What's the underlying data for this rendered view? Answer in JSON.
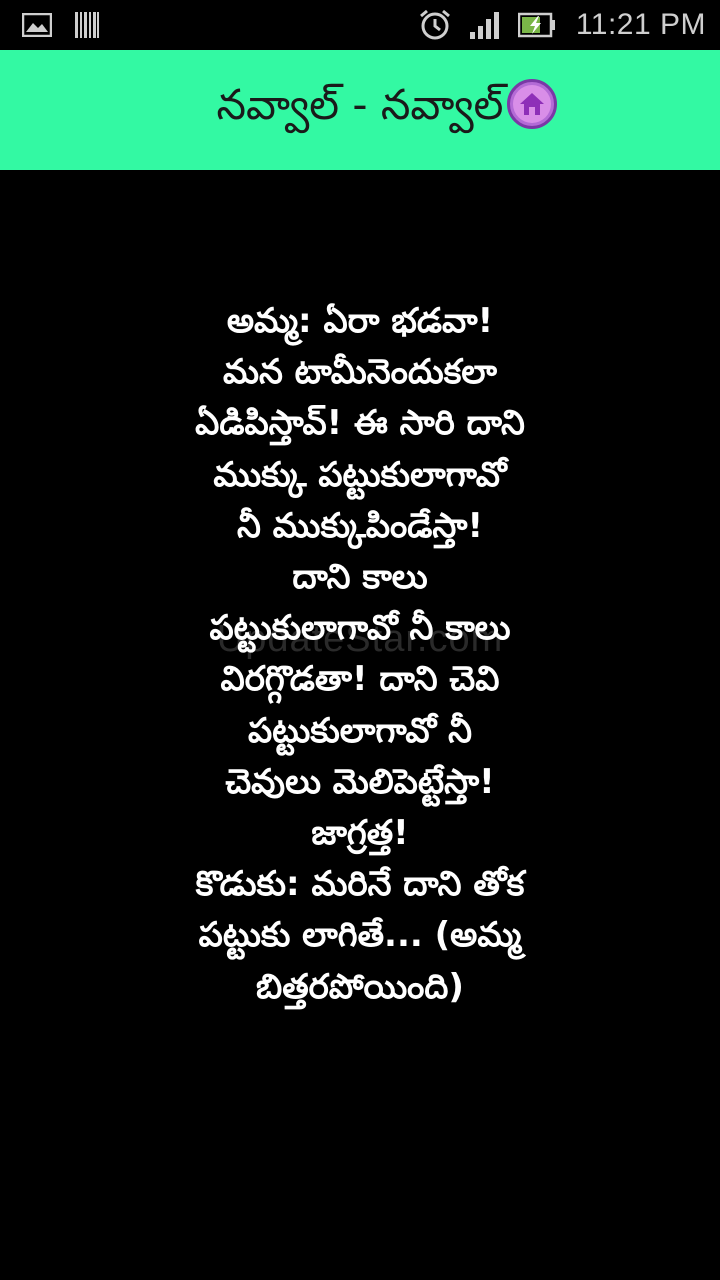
{
  "status_bar": {
    "time": "11:21 PM",
    "icons": [
      "gallery-icon",
      "barcode-icon",
      "alarm-icon",
      "signal-icon",
      "battery-charging-icon"
    ]
  },
  "app_bar": {
    "title": "నవ్వాల్ - నవ్వాల్",
    "home_icon": "home-icon"
  },
  "content": {
    "watermark": "UpdateStar.com",
    "joke_lines": [
      "అమ్మ: ఏరా భడవా!",
      "మన టామీనెందుకలా",
      "ఏడిపిస్తావ్! ఈ సారి దాని",
      "ముక్కు పట్టుకులాగావో",
      "నీ ముక్కుపిండేస్తా!",
      "దాని కాలు",
      "పట్టుకులాగావో నీ కాలు",
      "విరగ్గొడతా! దాని చెవి",
      "పట్టుకులాగావో నీ",
      "చెవులు మెలిపెట్టేస్తా!",
      "జాగ్రత్త!",
      "కొడుకు: మరినే దాని తోక",
      "పట్టుకు లాగితే... (అమ్మ",
      "బిత్తరపోయింది)"
    ]
  },
  "colors": {
    "app_bar_bg": "#33f9a3",
    "background": "#000000",
    "text": "#ffffff",
    "home_icon": "#b46bd6"
  }
}
